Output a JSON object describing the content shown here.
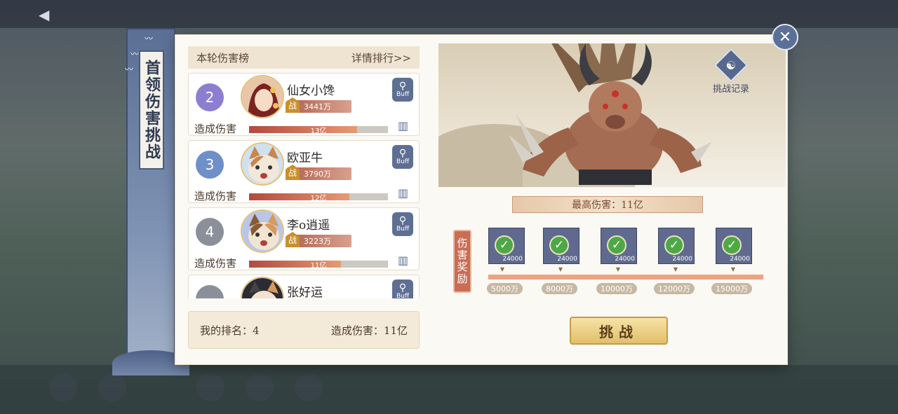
{
  "title": "首领伤害挑战",
  "left": {
    "header_title": "本轮伤害榜",
    "detail_link": "详情排行>>",
    "entries": [
      {
        "rank": "2",
        "name": "仙女小馋",
        "power": "3441万",
        "damage_label": "造成伤害",
        "damage_value": "13亿",
        "bar_fraction": 0.78,
        "badge_color": "#8d7fd0",
        "avatar": "woman-avatar"
      },
      {
        "rank": "3",
        "name": "欧亚牛",
        "power": "3790万",
        "damage_label": "造成伤害",
        "damage_value": "12亿",
        "bar_fraction": 0.72,
        "badge_color": "#6f8fc8",
        "avatar": "cat-avatar"
      },
      {
        "rank": "4",
        "name": "李o逍遥",
        "power": "3223万",
        "damage_label": "造成伤害",
        "damage_value": "11亿",
        "bar_fraction": 0.66,
        "badge_color": "#8b8f99",
        "avatar": "cat-avatar"
      },
      {
        "rank": "",
        "name": "张好运",
        "power": "",
        "damage_label": "",
        "damage_value": "",
        "bar_fraction": 0,
        "badge_color": "#8b8f99",
        "avatar": "cat-avatar"
      }
    ],
    "power_icon_text": "战",
    "buff_text": "Buff",
    "my_rank_label": "我的排名：4",
    "my_damage_label": "造成伤害：11亿"
  },
  "right": {
    "history_label": "挑战记录",
    "max_damage": "最高伤害：11亿",
    "reward_label": "伤害奖励",
    "rewards": [
      {
        "qty": "24000",
        "threshold": "5000万",
        "claimed": true
      },
      {
        "qty": "24000",
        "threshold": "8000万",
        "claimed": true
      },
      {
        "qty": "24000",
        "threshold": "10000万",
        "claimed": true
      },
      {
        "qty": "24000",
        "threshold": "12000万",
        "claimed": true
      },
      {
        "qty": "24000",
        "threshold": "15000万",
        "claimed": true
      }
    ],
    "challenge_label": "挑战"
  },
  "colors": {
    "accent": "#5b7099",
    "damage_bar": "#b24a3d",
    "reward_check": "#4ea845"
  }
}
